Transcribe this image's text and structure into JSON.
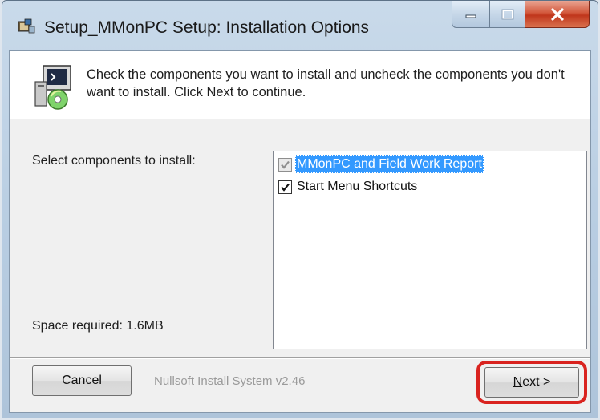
{
  "window": {
    "title": "Setup_MMonPC Setup: Installation Options"
  },
  "header": {
    "description": "Check the components you want to install and uncheck the components you don't want to install. Click Next to continue."
  },
  "body": {
    "select_label": "Select components to install:",
    "space_required": "Space required: 1.6MB"
  },
  "components": [
    {
      "label": "MMonPC and Field Work Report",
      "checked": true,
      "disabled": true,
      "selected": true
    },
    {
      "label": "Start Menu Shortcuts",
      "checked": true,
      "disabled": false,
      "selected": false
    }
  ],
  "footer": {
    "cancel_label": "Cancel",
    "branding": "Nullsoft Install System v2.46",
    "next_label_accel": "N",
    "next_label_rest": "ext >"
  },
  "colors": {
    "selection": "#3399ff",
    "highlight_ring": "#d9231f",
    "close_button": "#c0361c"
  }
}
